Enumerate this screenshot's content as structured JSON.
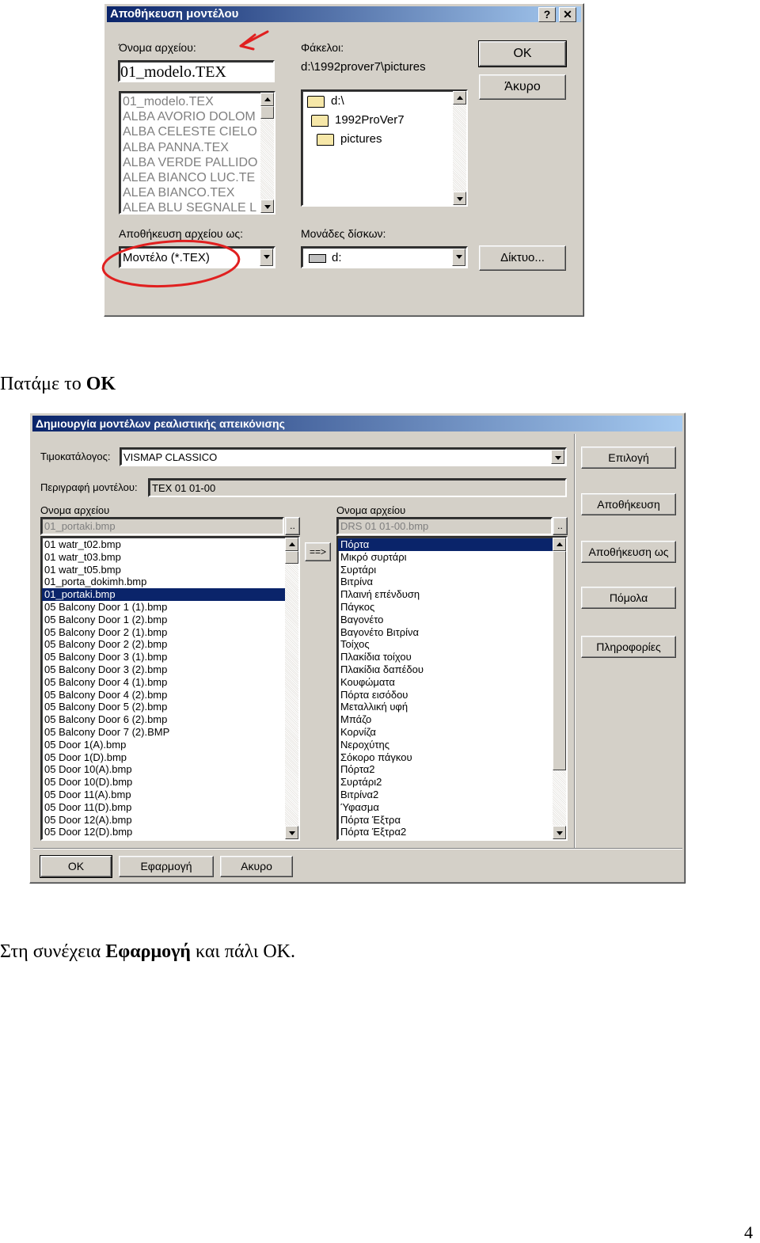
{
  "dialog1": {
    "title": "Αποθήκευση μοντέλου",
    "help_label": "?",
    "close_label": "✕",
    "filename_label": "Όνομα αρχείου:",
    "filename_value": "01_modelo.TEX",
    "files": [
      "01_modelo.TEX",
      "ALBA AVORIO DOLOM",
      "ALBA CELESTE CIELO",
      "ALBA PANNA.TEX",
      "ALBA VERDE PALLIDO",
      "ALEA BIANCO LUC.TE",
      "ALEA BIANCO.TEX",
      "ALEA BLU SEGNALE L"
    ],
    "folders_label": "Φάκελοι:",
    "folders_path": "d:\\1992prover7\\pictures",
    "folders": [
      "d:\\",
      "1992ProVer7",
      "pictures"
    ],
    "ok_label": "OK",
    "cancel_label": "Άκυρο",
    "save_as_label": "Αποθήκευση αρχείου ως:",
    "save_as_value": "Μοντέλο (*.TEX)",
    "drives_label": "Μονάδες δίσκων:",
    "drive_value": "d:",
    "network_label": "Δίκτυο..."
  },
  "caption1": "Πατάμε το ",
  "caption1_bold": "OK",
  "dialog2": {
    "title": "Δημιουργία μοντέλων ρεαλιστικής απεικόνισης",
    "catalog_label": "Τιμοκατάλογος:",
    "catalog_value": "VISMAP CLASSICO",
    "description_label": "Περιγραφή μοντέλου:",
    "description_value": "TEX 01 01-00",
    "left_filename_label": "Ονομα αρχείου",
    "left_filename_value": "01_portaki.bmp",
    "browse_label": "..",
    "right_filename_label": "Ονομα αρχείου",
    "right_filename_value": "DRS 01 01-00.bmp",
    "arrow_label": "==>",
    "left_files": [
      "01 watr_t02.bmp",
      "01 watr_t03.bmp",
      "01 watr_t05.bmp",
      "01_porta_dokimh.bmp",
      "01_portaki.bmp",
      "05 Balcony Door 1 (1).bmp",
      "05 Balcony Door 1 (2).bmp",
      "05 Balcony Door 2 (1).bmp",
      "05 Balcony Door 2 (2).bmp",
      "05 Balcony Door 3 (1).bmp",
      "05 Balcony Door 3 (2).bmp",
      "05 Balcony Door 4 (1).bmp",
      "05 Balcony Door 4 (2).bmp",
      "05 Balcony Door 5 (2).bmp",
      "05 Balcony Door 6 (2).bmp",
      "05 Balcony Door 7 (2).BMP",
      "05 Door 1(A).bmp",
      "05 Door 1(D).bmp",
      "05 Door 10(A).bmp",
      "05 Door 10(D).bmp",
      "05 Door 11(A).bmp",
      "05 Door 11(D).bmp",
      "05 Door 12(A).bmp",
      "05 Door 12(D).bmp"
    ],
    "right_items": [
      "Πόρτα",
      "Μικρό συρτάρι",
      "Συρτάρι",
      "Βιτρίνα",
      "Πλαινή επένδυση",
      "Πάγκος",
      "Βαγονέτο",
      "Βαγονέτο Βιτρίνα",
      "Τοίχος",
      "Πλακίδια τοίχου",
      "Πλακίδια δαπέδου",
      "Κουφώματα",
      "Πόρτα εισόδου",
      "Μεταλλική υφή",
      "Μπάζο",
      "Κορνίζα",
      "Νεροχύτης",
      "Σόκορο πάγκου",
      "Πόρτα2",
      "Συρτάρι2",
      "Βιτρίνα2",
      "Ύφασμα",
      "Πόρτα Έξτρα",
      "Πόρτα Έξτρα2"
    ],
    "select_label": "Επιλογή",
    "save_label": "Αποθήκευση",
    "save_as_label": "Αποθήκευση ως",
    "handles_label": "Πόμολα",
    "info_label": "Πληροφορίες",
    "ok_label": "OK",
    "apply_label": "Εφαρμογή",
    "cancel_label": "Ακυρο"
  },
  "caption2_pre": "Στη συνέχεια ",
  "caption2_bold": "Εφαρμογή",
  "caption2_post": " και πάλι ΟΚ.",
  "page_number": "4",
  "colors": {
    "annotation": "#e02020",
    "titlebar": "#0a246a",
    "selection": "#0a246a",
    "face": "#d4d0c8"
  }
}
